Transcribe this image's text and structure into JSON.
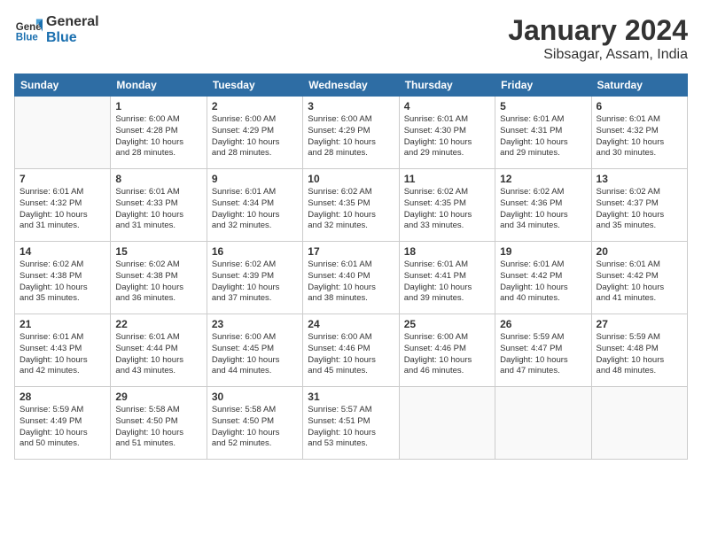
{
  "logo": {
    "line1": "General",
    "line2": "Blue"
  },
  "title": "January 2024",
  "subtitle": "Sibsagar, Assam, India",
  "weekdays": [
    "Sunday",
    "Monday",
    "Tuesday",
    "Wednesday",
    "Thursday",
    "Friday",
    "Saturday"
  ],
  "weeks": [
    [
      {
        "day": "",
        "info": ""
      },
      {
        "day": "1",
        "info": "Sunrise: 6:00 AM\nSunset: 4:28 PM\nDaylight: 10 hours\nand 28 minutes."
      },
      {
        "day": "2",
        "info": "Sunrise: 6:00 AM\nSunset: 4:29 PM\nDaylight: 10 hours\nand 28 minutes."
      },
      {
        "day": "3",
        "info": "Sunrise: 6:00 AM\nSunset: 4:29 PM\nDaylight: 10 hours\nand 28 minutes."
      },
      {
        "day": "4",
        "info": "Sunrise: 6:01 AM\nSunset: 4:30 PM\nDaylight: 10 hours\nand 29 minutes."
      },
      {
        "day": "5",
        "info": "Sunrise: 6:01 AM\nSunset: 4:31 PM\nDaylight: 10 hours\nand 29 minutes."
      },
      {
        "day": "6",
        "info": "Sunrise: 6:01 AM\nSunset: 4:32 PM\nDaylight: 10 hours\nand 30 minutes."
      }
    ],
    [
      {
        "day": "7",
        "info": "Sunrise: 6:01 AM\nSunset: 4:32 PM\nDaylight: 10 hours\nand 31 minutes."
      },
      {
        "day": "8",
        "info": "Sunrise: 6:01 AM\nSunset: 4:33 PM\nDaylight: 10 hours\nand 31 minutes."
      },
      {
        "day": "9",
        "info": "Sunrise: 6:01 AM\nSunset: 4:34 PM\nDaylight: 10 hours\nand 32 minutes."
      },
      {
        "day": "10",
        "info": "Sunrise: 6:02 AM\nSunset: 4:35 PM\nDaylight: 10 hours\nand 32 minutes."
      },
      {
        "day": "11",
        "info": "Sunrise: 6:02 AM\nSunset: 4:35 PM\nDaylight: 10 hours\nand 33 minutes."
      },
      {
        "day": "12",
        "info": "Sunrise: 6:02 AM\nSunset: 4:36 PM\nDaylight: 10 hours\nand 34 minutes."
      },
      {
        "day": "13",
        "info": "Sunrise: 6:02 AM\nSunset: 4:37 PM\nDaylight: 10 hours\nand 35 minutes."
      }
    ],
    [
      {
        "day": "14",
        "info": "Sunrise: 6:02 AM\nSunset: 4:38 PM\nDaylight: 10 hours\nand 35 minutes."
      },
      {
        "day": "15",
        "info": "Sunrise: 6:02 AM\nSunset: 4:38 PM\nDaylight: 10 hours\nand 36 minutes."
      },
      {
        "day": "16",
        "info": "Sunrise: 6:02 AM\nSunset: 4:39 PM\nDaylight: 10 hours\nand 37 minutes."
      },
      {
        "day": "17",
        "info": "Sunrise: 6:01 AM\nSunset: 4:40 PM\nDaylight: 10 hours\nand 38 minutes."
      },
      {
        "day": "18",
        "info": "Sunrise: 6:01 AM\nSunset: 4:41 PM\nDaylight: 10 hours\nand 39 minutes."
      },
      {
        "day": "19",
        "info": "Sunrise: 6:01 AM\nSunset: 4:42 PM\nDaylight: 10 hours\nand 40 minutes."
      },
      {
        "day": "20",
        "info": "Sunrise: 6:01 AM\nSunset: 4:42 PM\nDaylight: 10 hours\nand 41 minutes."
      }
    ],
    [
      {
        "day": "21",
        "info": "Sunrise: 6:01 AM\nSunset: 4:43 PM\nDaylight: 10 hours\nand 42 minutes."
      },
      {
        "day": "22",
        "info": "Sunrise: 6:01 AM\nSunset: 4:44 PM\nDaylight: 10 hours\nand 43 minutes."
      },
      {
        "day": "23",
        "info": "Sunrise: 6:00 AM\nSunset: 4:45 PM\nDaylight: 10 hours\nand 44 minutes."
      },
      {
        "day": "24",
        "info": "Sunrise: 6:00 AM\nSunset: 4:46 PM\nDaylight: 10 hours\nand 45 minutes."
      },
      {
        "day": "25",
        "info": "Sunrise: 6:00 AM\nSunset: 4:46 PM\nDaylight: 10 hours\nand 46 minutes."
      },
      {
        "day": "26",
        "info": "Sunrise: 5:59 AM\nSunset: 4:47 PM\nDaylight: 10 hours\nand 47 minutes."
      },
      {
        "day": "27",
        "info": "Sunrise: 5:59 AM\nSunset: 4:48 PM\nDaylight: 10 hours\nand 48 minutes."
      }
    ],
    [
      {
        "day": "28",
        "info": "Sunrise: 5:59 AM\nSunset: 4:49 PM\nDaylight: 10 hours\nand 50 minutes."
      },
      {
        "day": "29",
        "info": "Sunrise: 5:58 AM\nSunset: 4:50 PM\nDaylight: 10 hours\nand 51 minutes."
      },
      {
        "day": "30",
        "info": "Sunrise: 5:58 AM\nSunset: 4:50 PM\nDaylight: 10 hours\nand 52 minutes."
      },
      {
        "day": "31",
        "info": "Sunrise: 5:57 AM\nSunset: 4:51 PM\nDaylight: 10 hours\nand 53 minutes."
      },
      {
        "day": "",
        "info": ""
      },
      {
        "day": "",
        "info": ""
      },
      {
        "day": "",
        "info": ""
      }
    ]
  ]
}
